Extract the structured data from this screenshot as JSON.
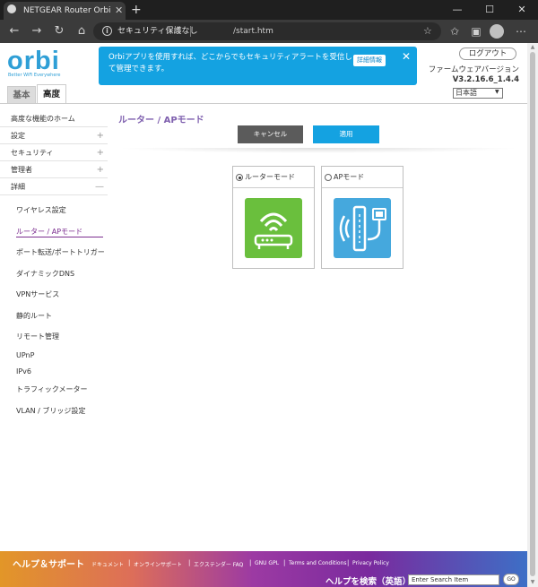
{
  "browser": {
    "tab_title": "NETGEAR Router Orbi",
    "tab_close": "✕",
    "new_tab": "+",
    "window_controls": {
      "minimize": "—",
      "maximize": "☐",
      "close": "✕"
    },
    "nav": {
      "back": "←",
      "forward": "→",
      "reload": "↻",
      "home": "⌂"
    },
    "security_label": "セキュリティ保護なし",
    "url": "/start.htm",
    "toolbar_icons": [
      "star-icon",
      "favorites-icon",
      "collections-icon",
      "profile-icon",
      "more-icon"
    ]
  },
  "header": {
    "logo": "orbi",
    "tagline": "Better WiFi Everywhere",
    "banner_text": "Orbiアプリを使用すれば、どこからでもセキュリティアラートを受信して管理できます。",
    "banner_link": "詳細情報",
    "banner_close": "✕",
    "logout": "ログアウト",
    "fw_label": "ファームウェアバージョン",
    "fw_version": "V3.2.16.6_1.4.4",
    "language": "日本語",
    "tabs": {
      "basic": "基本",
      "advanced": "高度"
    }
  },
  "sidebar": {
    "items": [
      {
        "label": "高度な機能のホーム",
        "expand": ""
      },
      {
        "label": "設定",
        "expand": "+"
      },
      {
        "label": "セキュリティ",
        "expand": "+"
      },
      {
        "label": "管理者",
        "expand": "+"
      },
      {
        "label": "詳細",
        "expand": "—"
      }
    ],
    "subitems": [
      "ワイヤレス設定",
      "ルーター / APモード",
      "ポート転送/ポートトリガー",
      "ダイナミックDNS",
      "VPNサービス",
      "静的ルート",
      "リモート管理",
      "UPnP",
      "IPv6",
      "トラフィックメーター",
      "VLAN / ブリッジ設定"
    ],
    "active_subitem": "ルーター / APモード"
  },
  "main": {
    "title": "ルーター / APモード",
    "cancel": "キャンセル",
    "apply": "適用",
    "modes": [
      {
        "label": "ルーターモード",
        "selected": true,
        "icon": "router-icon",
        "color": "#6abf3d"
      },
      {
        "label": "APモード",
        "selected": false,
        "icon": "access-point-icon",
        "color": "#45a8dd"
      }
    ]
  },
  "footer": {
    "title": "ヘルプ＆サポート",
    "links": [
      "ドキュメント",
      "オンラインサポート",
      "エクステンダー FAQ",
      "GNU GPL",
      "Terms and Conditions",
      "Privacy Policy"
    ],
    "search_label": "ヘルプを検索（英語）",
    "search_value": "Enter Search Item",
    "go": "GO"
  },
  "colors": {
    "accent": "#14a2e1",
    "purple": "#7b2d8f",
    "router_green": "#6abf3d",
    "ap_blue": "#45a8dd"
  }
}
